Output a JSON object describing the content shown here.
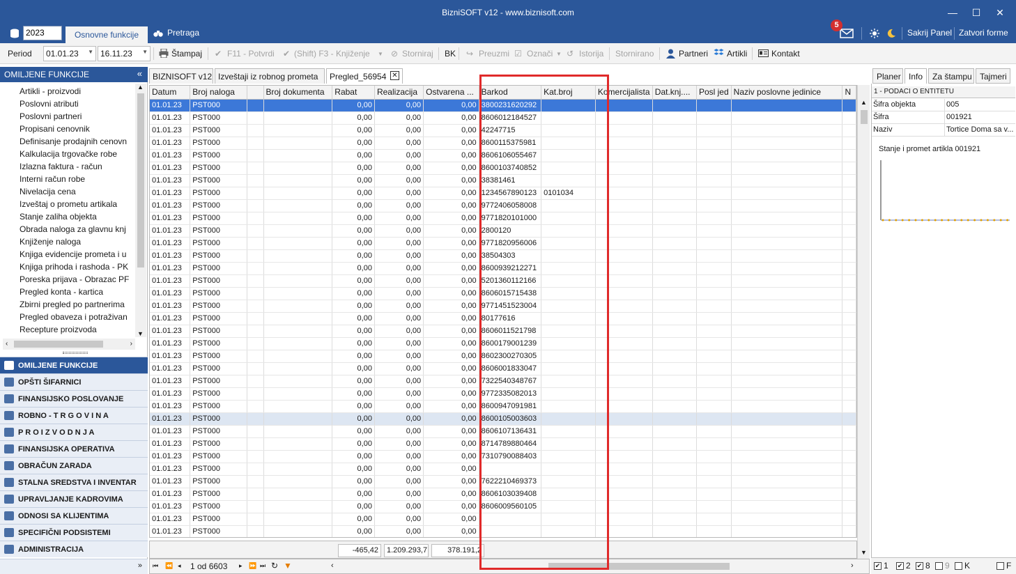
{
  "window": {
    "title": "BizniSOFT v12 - www.biznisoft.com",
    "min_glyph": "—",
    "max_glyph": "☐",
    "close_glyph": "✕"
  },
  "tabs_row": {
    "year": "2023",
    "active_tab": "Osnovne funkcije",
    "search_tab": "Pretraga",
    "mail_badge": "5",
    "hide_panel": "Sakrij Panel",
    "close_forms": "Zatvori forme"
  },
  "toolbar": {
    "period_label": "Period",
    "date_from": "01.01.23",
    "date_to": "16.11.23",
    "print": "Štampaj",
    "confirm": "F11 - Potvrdi",
    "post": "(Shift) F3 - Knjiženje",
    "cancel": "Storniraj",
    "bk": "BK",
    "take": "Preuzmi",
    "mark": "Označi",
    "history": "Istorija",
    "cancelled": "Stornirano",
    "partners": "Partneri",
    "articles": "Artikli",
    "contact": "Kontakt"
  },
  "left_panel": {
    "header": "OMILJENE FUNKCIJE",
    "favorites": [
      "Artikli - proizvodi",
      "Poslovni atributi",
      "Poslovni partneri",
      "Propisani cenovnik",
      "Definisanje prodajnih cenovn",
      "Kalkulacija trgovačke robe",
      "Izlazna faktura - račun",
      "Interni račun robe",
      "Nivelacija cena",
      "Izveštaj o prometu artikala",
      "Stanje zaliha objekta",
      "Obrada naloga za glavnu knj",
      "Knjiženje naloga",
      "Knjiga evidencije prometa i u",
      "Knjiga prihoda i rashoda - PK",
      "Poreska prijava - Obrazac PF",
      "Pregled konta - kartica",
      "Zbirni pregled po partnerima",
      "Pregled obaveza i potraživan",
      "Recepture proizvoda"
    ],
    "modules": [
      "OMILJENE FUNKCIJE",
      "OPŠTI ŠIFARNICI",
      "FINANSIJSKO POSLOVANJE",
      "ROBNO - T R G O V I N A",
      "P R O I Z V O D N J A",
      "FINANSIJSKA OPERATIVA",
      "OBRAČUN ZARADA",
      "STALNA SREDSTVA I INVENTAR",
      "UPRAVLJANJE KADROVIMA",
      "ODNOSI SA KLIJENTIMA",
      "SPECIFIČNI PODSISTEMI",
      "ADMINISTRACIJA"
    ]
  },
  "doc_tabs": [
    "BIZNISOFT v12",
    "Izveštaji iz robnog prometa",
    "Pregled_56954"
  ],
  "grid": {
    "columns": [
      "Datum",
      "Broj naloga",
      "",
      "Broj dokumenta",
      "Rabat",
      "Realizacija",
      "Ostvarena ...",
      "Barkod",
      "Kat.broj",
      "Komercijalista",
      "Dat.knj....",
      "Posl jed",
      "Naziv poslovne jedinice",
      "N"
    ],
    "date": "01.01.23",
    "order": "PST000",
    "zero": "0,00",
    "barcodes": [
      "3800231620292",
      "8606012184527",
      "42247715",
      "8600115375981",
      "8606106055467",
      "8600103740852",
      "38381461",
      "1234567890123",
      "9772406058008",
      "9771820101000",
      "2800120",
      "9771820956006",
      "38504303",
      "8600939212271",
      "5201360112166",
      "8606015715438",
      "9771451523004",
      "80177616",
      "8606011521798",
      "8600179001239",
      "8602300270305",
      "8606001833047",
      "7322540348767",
      "9772335082013",
      "8600947091981",
      "8600105003603",
      "8606107136431",
      "8714789880464",
      "7310790088403",
      "",
      "7622210469373",
      "8606103039408",
      "8606009560105",
      "",
      ""
    ],
    "cat_number_row": 7,
    "cat_number": "0101034",
    "sums": [
      "-465,42",
      "1.209.293,7",
      "378.191,2"
    ],
    "record_counter": "1 od 6603"
  },
  "right_panel": {
    "tabs": [
      "Planer",
      "Info",
      "Za štampu",
      "Tajmeri"
    ],
    "section": "1 - PODACI O ENTITETU",
    "rows": [
      {
        "k": "Šifra objekta",
        "v": "005"
      },
      {
        "k": "Šifra",
        "v": "001921"
      },
      {
        "k": "Naziv",
        "v": "Tortice Doma sa v..."
      }
    ],
    "chart_title": "Stanje i promet artikla 001921",
    "bottom": [
      "1",
      "2",
      "8",
      "9",
      "K",
      "F"
    ]
  },
  "colors": {
    "accent": "#2b579a",
    "selected_row": "#3c78d8",
    "highlight_box": "#e02a2a"
  }
}
